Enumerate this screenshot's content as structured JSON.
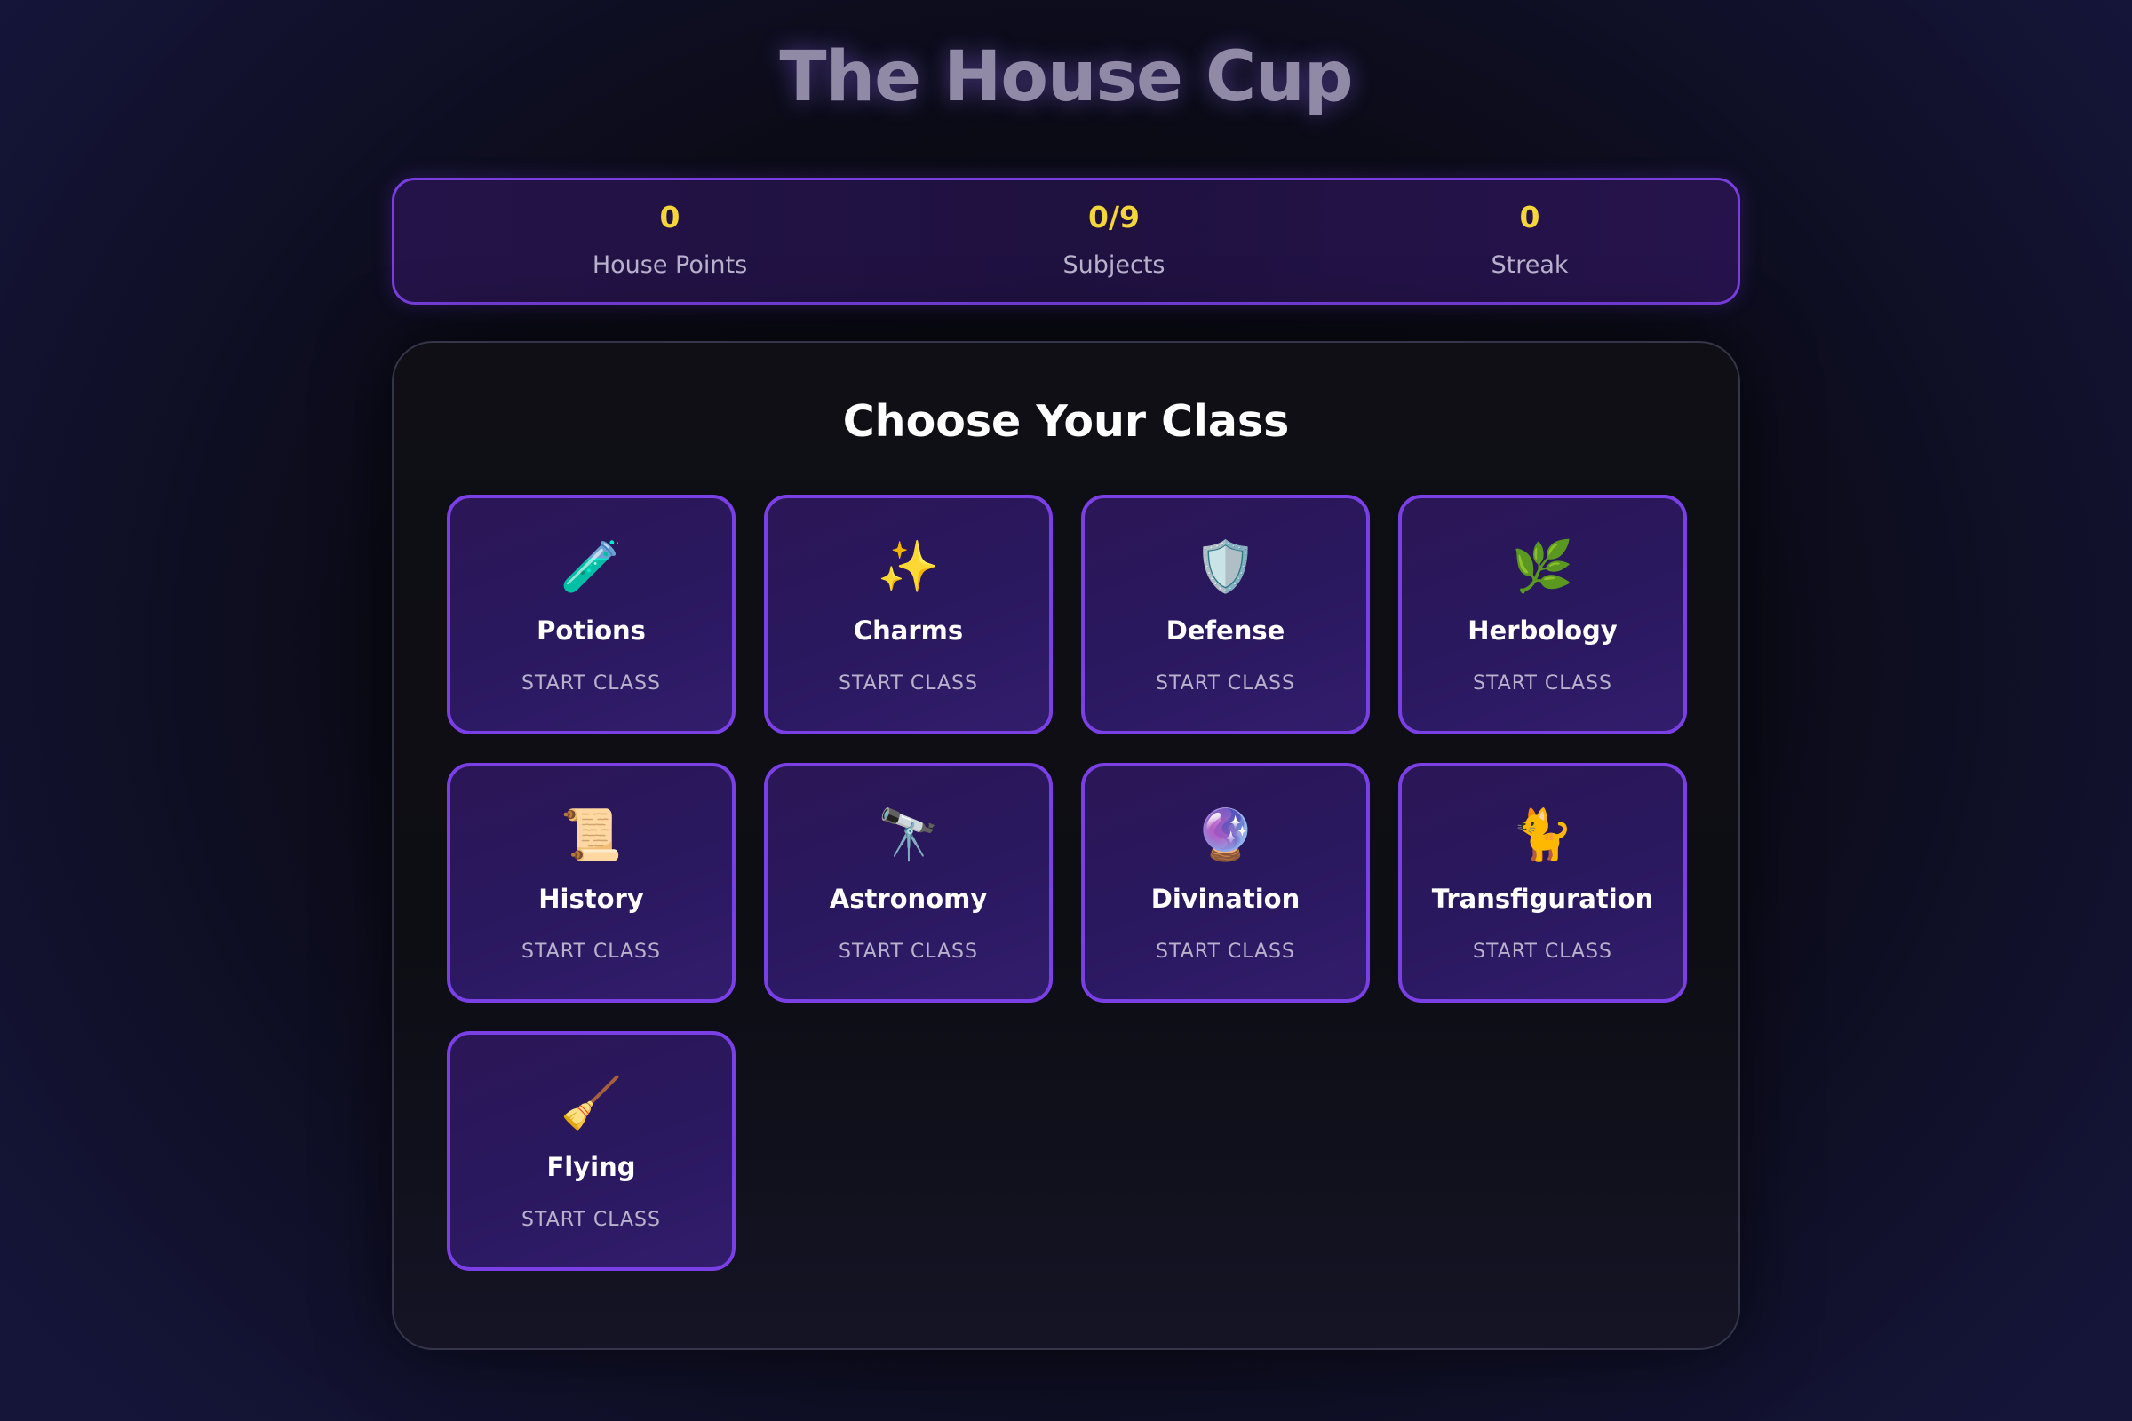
{
  "header": {
    "title": "The House Cup"
  },
  "stats": [
    {
      "value": "0",
      "label": "House Points"
    },
    {
      "value": "0/9",
      "label": "Subjects"
    },
    {
      "value": "0",
      "label": "Streak"
    }
  ],
  "panel": {
    "title": "Choose Your Class"
  },
  "classes": [
    {
      "icon": "test-tube-icon",
      "glyph": "🧪",
      "name": "Potions",
      "action": "START CLASS"
    },
    {
      "icon": "sparkles-icon",
      "glyph": "✨",
      "name": "Charms",
      "action": "START CLASS"
    },
    {
      "icon": "shield-icon",
      "glyph": "🛡️",
      "name": "Defense",
      "action": "START CLASS"
    },
    {
      "icon": "herb-icon",
      "glyph": "🌿",
      "name": "Herbology",
      "action": "START CLASS"
    },
    {
      "icon": "scroll-icon",
      "glyph": "📜",
      "name": "History",
      "action": "START CLASS"
    },
    {
      "icon": "telescope-icon",
      "glyph": "🔭",
      "name": "Astronomy",
      "action": "START CLASS"
    },
    {
      "icon": "crystal-ball-icon",
      "glyph": "🔮",
      "name": "Divination",
      "action": "START CLASS"
    },
    {
      "icon": "cat-icon",
      "glyph": "🐈",
      "name": "Transfiguration",
      "action": "START CLASS"
    },
    {
      "icon": "broom-icon",
      "glyph": "🧹",
      "name": "Flying",
      "action": "START CLASS"
    }
  ],
  "colors": {
    "accent": "#7b3fe6",
    "stat_value": "#f5d63a",
    "card_bg": "#2b1656",
    "page_bg": "#0b0b17"
  }
}
